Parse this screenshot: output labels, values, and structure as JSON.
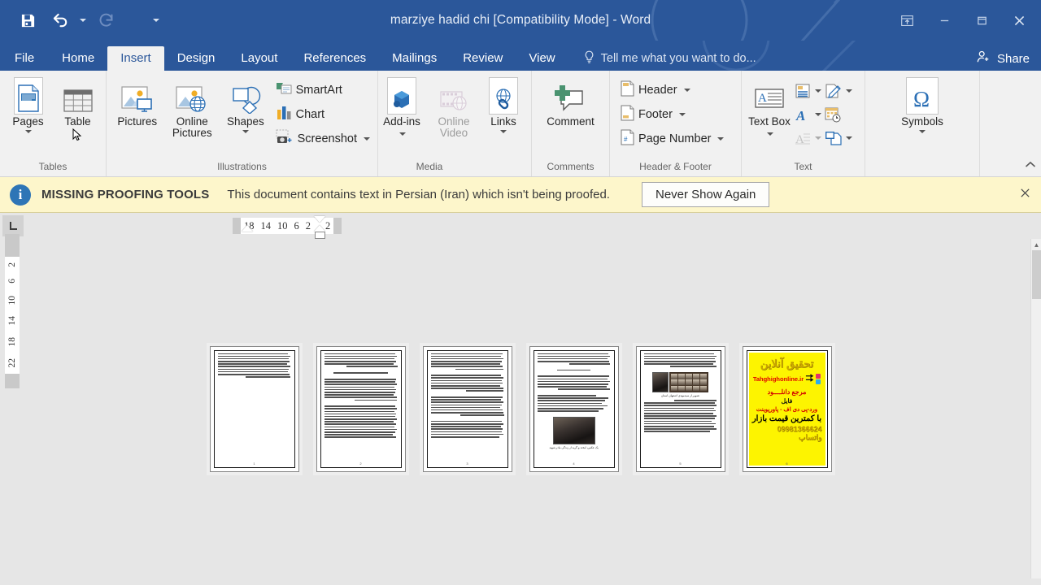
{
  "window": {
    "title": "marziye hadid chi [Compatibility Mode] - Word",
    "quick_access": [
      {
        "name": "save",
        "icon": "save-icon"
      },
      {
        "name": "undo",
        "icon": "undo-icon"
      },
      {
        "name": "redo",
        "icon": "redo-icon"
      },
      {
        "name": "customize",
        "icon": "chevron-down-icon"
      }
    ],
    "controls": [
      {
        "name": "ribbon-display-options",
        "icon": "ribbon-options-icon"
      },
      {
        "name": "minimize",
        "icon": "minimize-icon"
      },
      {
        "name": "restore",
        "icon": "restore-icon"
      },
      {
        "name": "close",
        "icon": "close-icon"
      }
    ],
    "colors": {
      "titlebar": "#2b579a",
      "ribbon": "#f1f1f1",
      "workspace": "#e6e6e6",
      "message_bar": "#fdf6cb",
      "accent": "#2b579a"
    }
  },
  "tabs": [
    {
      "label": "File",
      "active": false
    },
    {
      "label": "Home",
      "active": false
    },
    {
      "label": "Insert",
      "active": true
    },
    {
      "label": "Design",
      "active": false
    },
    {
      "label": "Layout",
      "active": false
    },
    {
      "label": "References",
      "active": false
    },
    {
      "label": "Mailings",
      "active": false
    },
    {
      "label": "Review",
      "active": false
    },
    {
      "label": "View",
      "active": false
    }
  ],
  "tell_me": {
    "placeholder": "Tell me what you want to do...",
    "icon": "lightbulb-icon"
  },
  "share": {
    "label": "Share",
    "icon": "person-add-icon"
  },
  "ribbon": {
    "groups": [
      {
        "label": "Tables",
        "name": "group-pages-tables",
        "items": [
          {
            "label": "Pages",
            "icon": "pages-icon",
            "dropdown": true,
            "selected": true
          },
          {
            "label": "Table",
            "icon": "table-icon",
            "dropdown": false
          }
        ]
      },
      {
        "label": "Illustrations",
        "name": "group-illustrations",
        "items": [
          {
            "label": "Pictures",
            "icon": "pictures-icon"
          },
          {
            "label": "Online Pictures",
            "icon": "online-pictures-icon"
          },
          {
            "label": "Shapes",
            "icon": "shapes-icon",
            "dropdown": true
          }
        ],
        "small_items": [
          {
            "label": "SmartArt",
            "icon": "smartart-icon"
          },
          {
            "label": "Chart",
            "icon": "chart-icon"
          },
          {
            "label": "Screenshot",
            "icon": "screenshot-icon",
            "dropdown": true
          }
        ]
      },
      {
        "label": "Media",
        "name": "group-media",
        "items": [
          {
            "label": "Add-ins",
            "icon": "addins-icon",
            "dropdown": true
          },
          {
            "label": "Online Video",
            "icon": "online-video-icon",
            "disabled": true
          },
          {
            "label": "Links",
            "icon": "links-icon",
            "dropdown": true
          }
        ]
      },
      {
        "label": "Comments",
        "name": "group-comments",
        "items": [
          {
            "label": "Comment",
            "icon": "comment-icon"
          }
        ]
      },
      {
        "label": "Header & Footer",
        "name": "group-header-footer",
        "small_items": [
          {
            "label": "Header",
            "icon": "header-icon",
            "dropdown": true
          },
          {
            "label": "Footer",
            "icon": "footer-icon",
            "dropdown": true
          },
          {
            "label": "Page Number",
            "icon": "page-number-icon",
            "dropdown": true
          }
        ]
      },
      {
        "label": "Text",
        "name": "group-text",
        "items": [
          {
            "label": "Text Box",
            "icon": "text-box-icon",
            "dropdown": true
          }
        ],
        "icon_grid": [
          {
            "icon": "quick-parts-icon",
            "dropdown": true
          },
          {
            "icon": "signature-line-icon",
            "dropdown": true
          },
          {
            "icon": "wordart-icon",
            "dropdown": true
          },
          {
            "icon": "date-time-icon",
            "dropdown": false
          },
          {
            "icon": "drop-cap-icon",
            "dropdown": true,
            "disabled": true
          },
          {
            "icon": "object-icon",
            "dropdown": true
          }
        ]
      },
      {
        "label": "",
        "name": "group-symbols",
        "items": [
          {
            "label": "Symbols",
            "icon": "omega-icon",
            "dropdown": true
          }
        ]
      }
    ],
    "collapse": {
      "name": "collapse-ribbon-button",
      "icon": "chevron-up-icon"
    }
  },
  "message_bar": {
    "icon": "info-icon",
    "title": "MISSING PROOFING TOOLS",
    "text": "This document contains text in Persian (Iran) which isn't being proofed.",
    "button": "Never Show Again",
    "close_icon": "close-icon"
  },
  "ruler": {
    "tab_stop_icon": "left-tab-stop-icon",
    "horizontal_marks": [
      "18",
      "14",
      "10",
      "6",
      "2",
      "2"
    ],
    "vertical_marks": [
      "2",
      "2",
      "6",
      "10",
      "14",
      "18",
      "22"
    ]
  },
  "document": {
    "view": "multiple-pages",
    "page_count": 6,
    "pages": [
      {
        "number": "1",
        "name": "page-thumbnail-1",
        "type": "text-partial"
      },
      {
        "number": "2",
        "name": "page-thumbnail-2",
        "type": "text-full"
      },
      {
        "number": "3",
        "name": "page-thumbnail-3",
        "type": "text-full"
      },
      {
        "number": "4",
        "name": "page-thumbnail-4",
        "type": "text-with-photo"
      },
      {
        "number": "5",
        "name": "page-thumbnail-5",
        "type": "text-with-photo-grid"
      },
      {
        "number": "6",
        "name": "page-thumbnail-6",
        "type": "advertisement"
      }
    ],
    "advertisement": {
      "heading": "تحقیق آنلاین",
      "site": "Tahghighonline.ir",
      "line1": "مرجع دانلــــود",
      "line2": "فایل",
      "line3": "ورد-پی دی اف - پاورپوینت",
      "line4": "با کمترین قیمت بازار",
      "line5": "09981366624 واتساپ"
    },
    "captions": {
      "page4": "یک عکس، لبخند و گریه از زندگی مادر شهید",
      "page5": "تصویر از سیدمهدی اصفهان استان"
    }
  }
}
